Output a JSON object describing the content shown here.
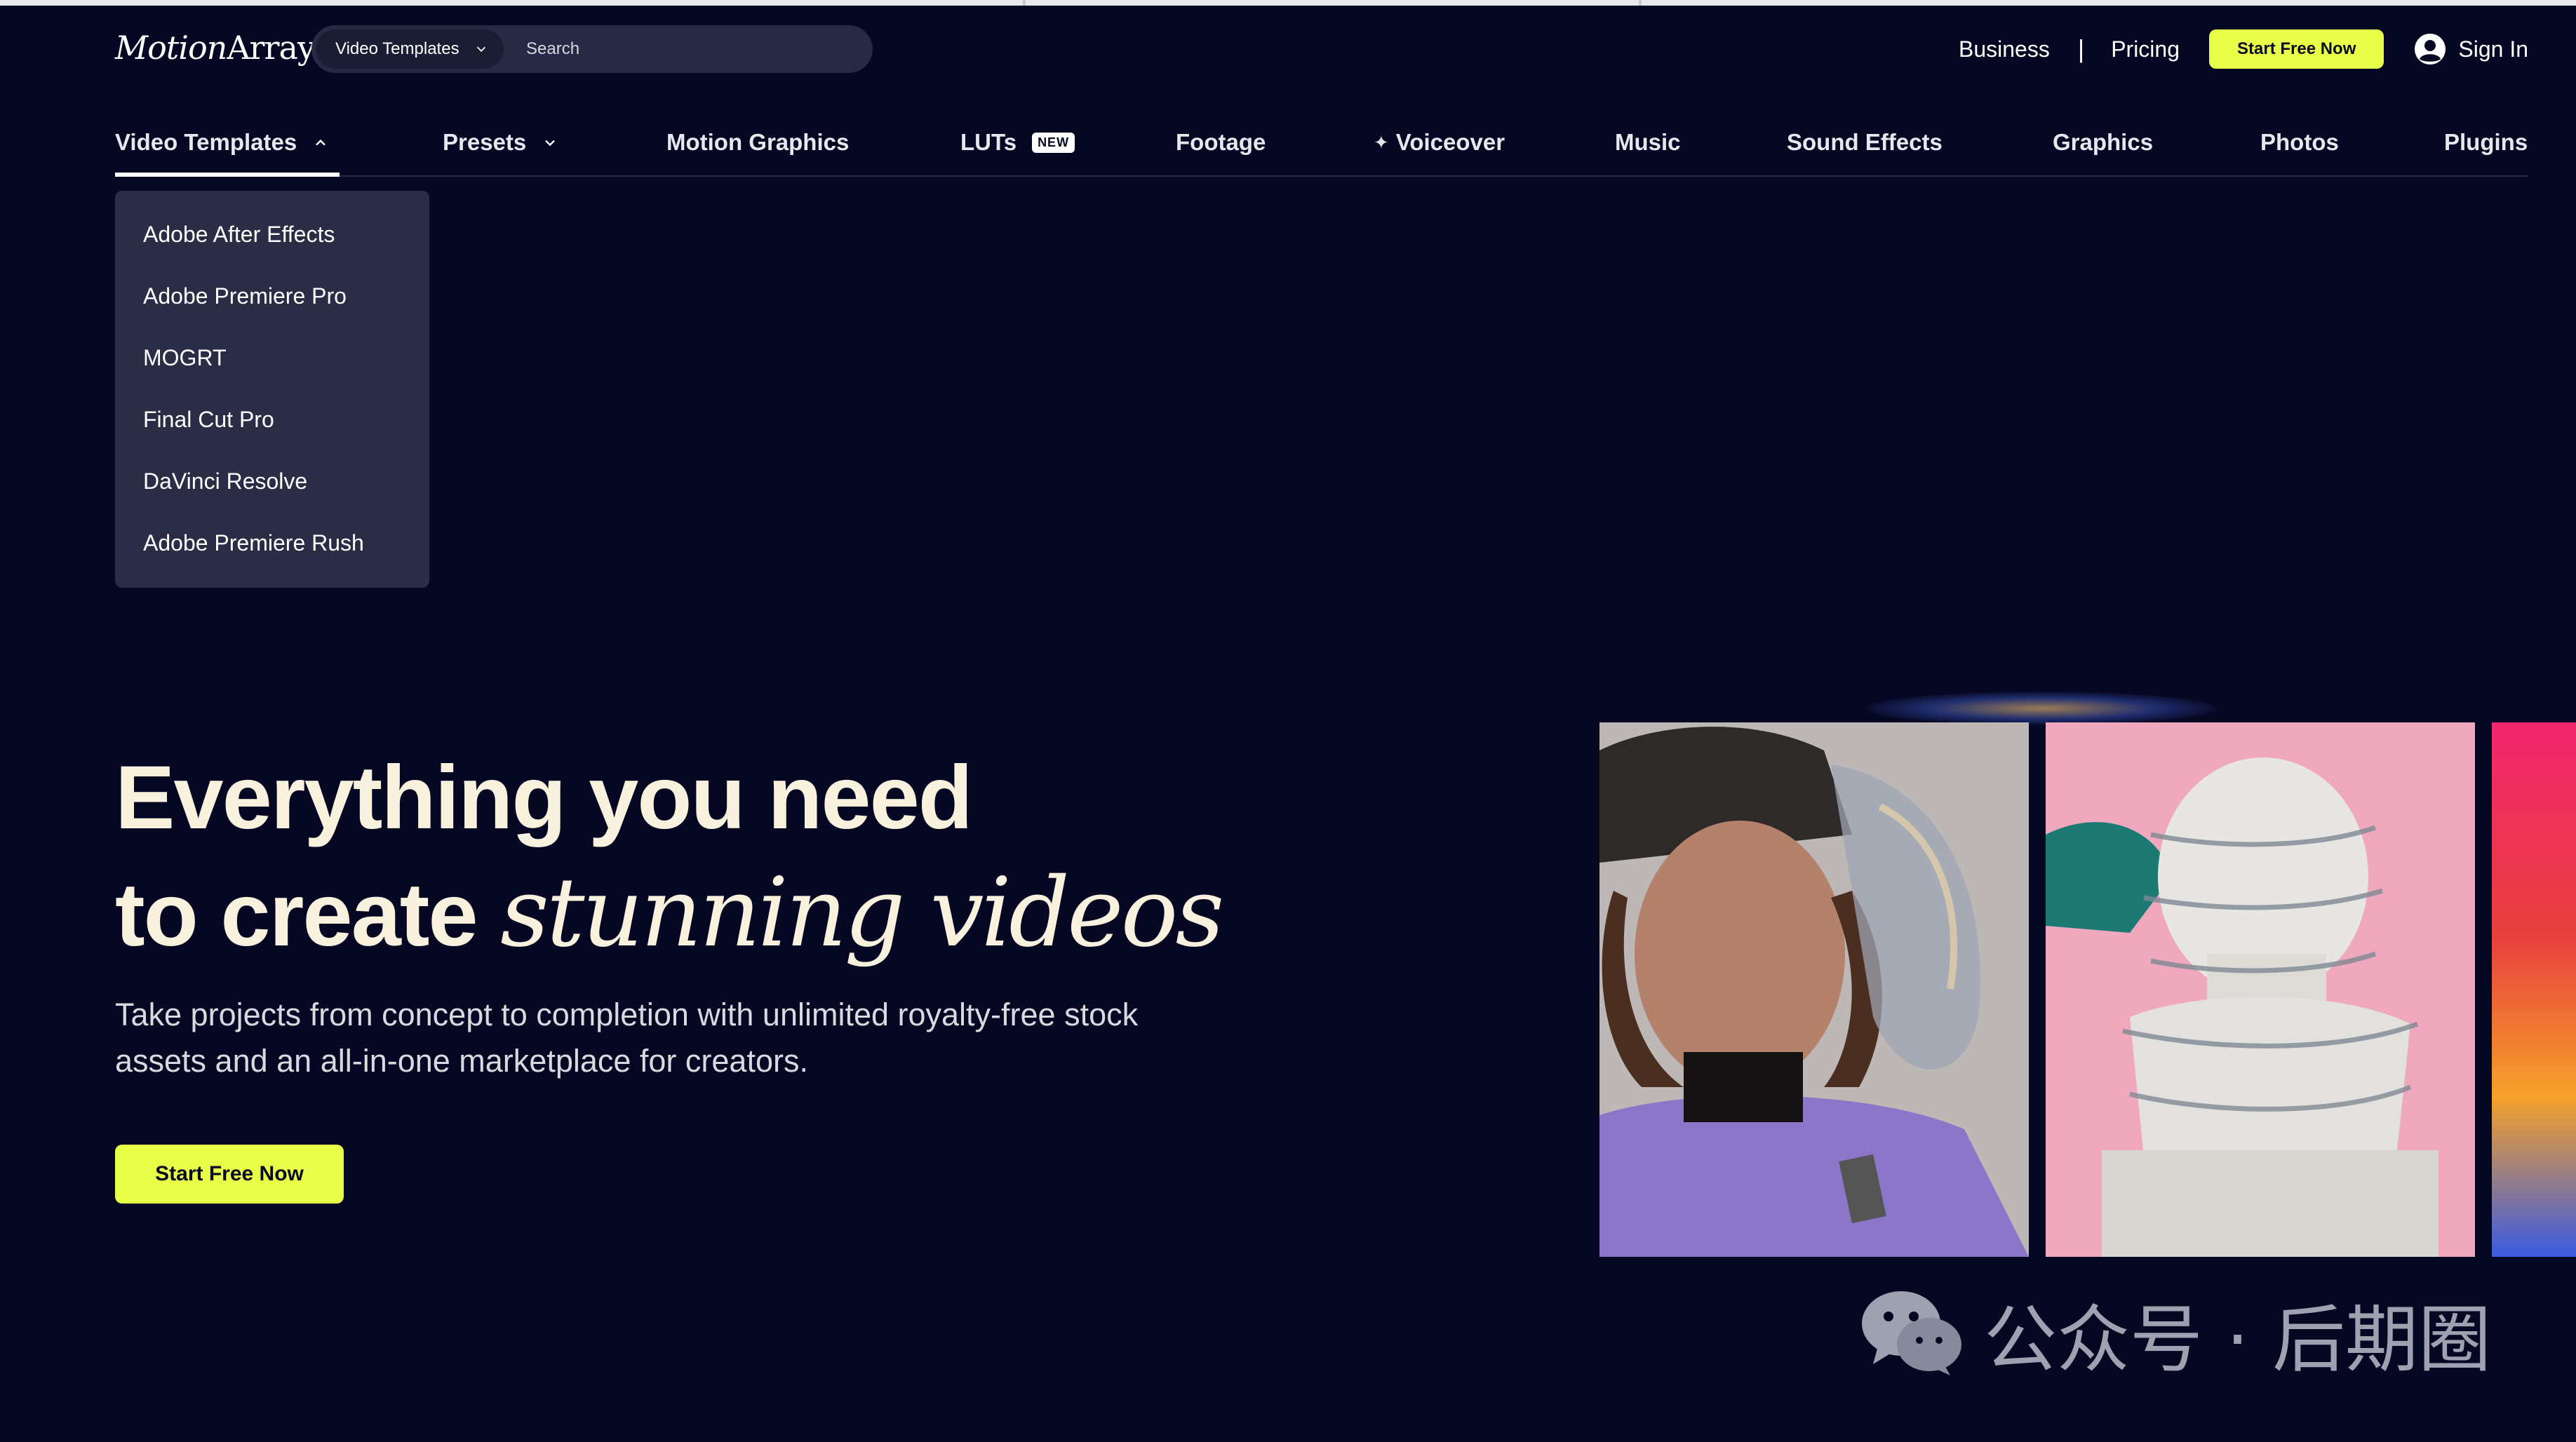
{
  "header": {
    "logo_text_a": "Motion",
    "logo_text_b": "Array",
    "search": {
      "category": "Video Templates",
      "placeholder": "Search"
    },
    "links": {
      "business": "Business",
      "separator": "|",
      "pricing": "Pricing"
    },
    "cta": "Start Free Now",
    "sign_in": "Sign In"
  },
  "nav": {
    "items": [
      {
        "label": "Video Templates",
        "active": true,
        "icon": "chevron-up-icon"
      },
      {
        "label": "Presets",
        "icon": "chevron-down-icon"
      },
      {
        "label": "Motion Graphics"
      },
      {
        "label": "LUTs",
        "badge": "NEW"
      },
      {
        "label": "Footage"
      },
      {
        "label": "Voiceover",
        "icon": "sparkle-icon"
      },
      {
        "label": "Music"
      },
      {
        "label": "Sound Effects"
      },
      {
        "label": "Graphics"
      },
      {
        "label": "Photos"
      },
      {
        "label": "Plugins"
      }
    ]
  },
  "dropdown": {
    "items": [
      "Adobe After Effects",
      "Adobe Premiere Pro",
      "MOGRT",
      "Final Cut Pro",
      "DaVinci Resolve",
      "Adobe Premiere Rush"
    ]
  },
  "hero": {
    "line1": "Everything you need",
    "line2_plain": "to create ",
    "line2_styled": "stunning videos",
    "subtext": "Take projects from concept to completion with unlimited royalty-free stock assets and an all-in-one marketplace for creators.",
    "cta": "Start Free Now"
  },
  "watermark": {
    "text": "公众号 · 后期圈",
    "icon": "wechat-icon"
  },
  "colors": {
    "background": "#060722",
    "accent": "#e8ff4a",
    "hero_text": "#f8f1dd",
    "dropdown_bg": "#2b2c45"
  }
}
